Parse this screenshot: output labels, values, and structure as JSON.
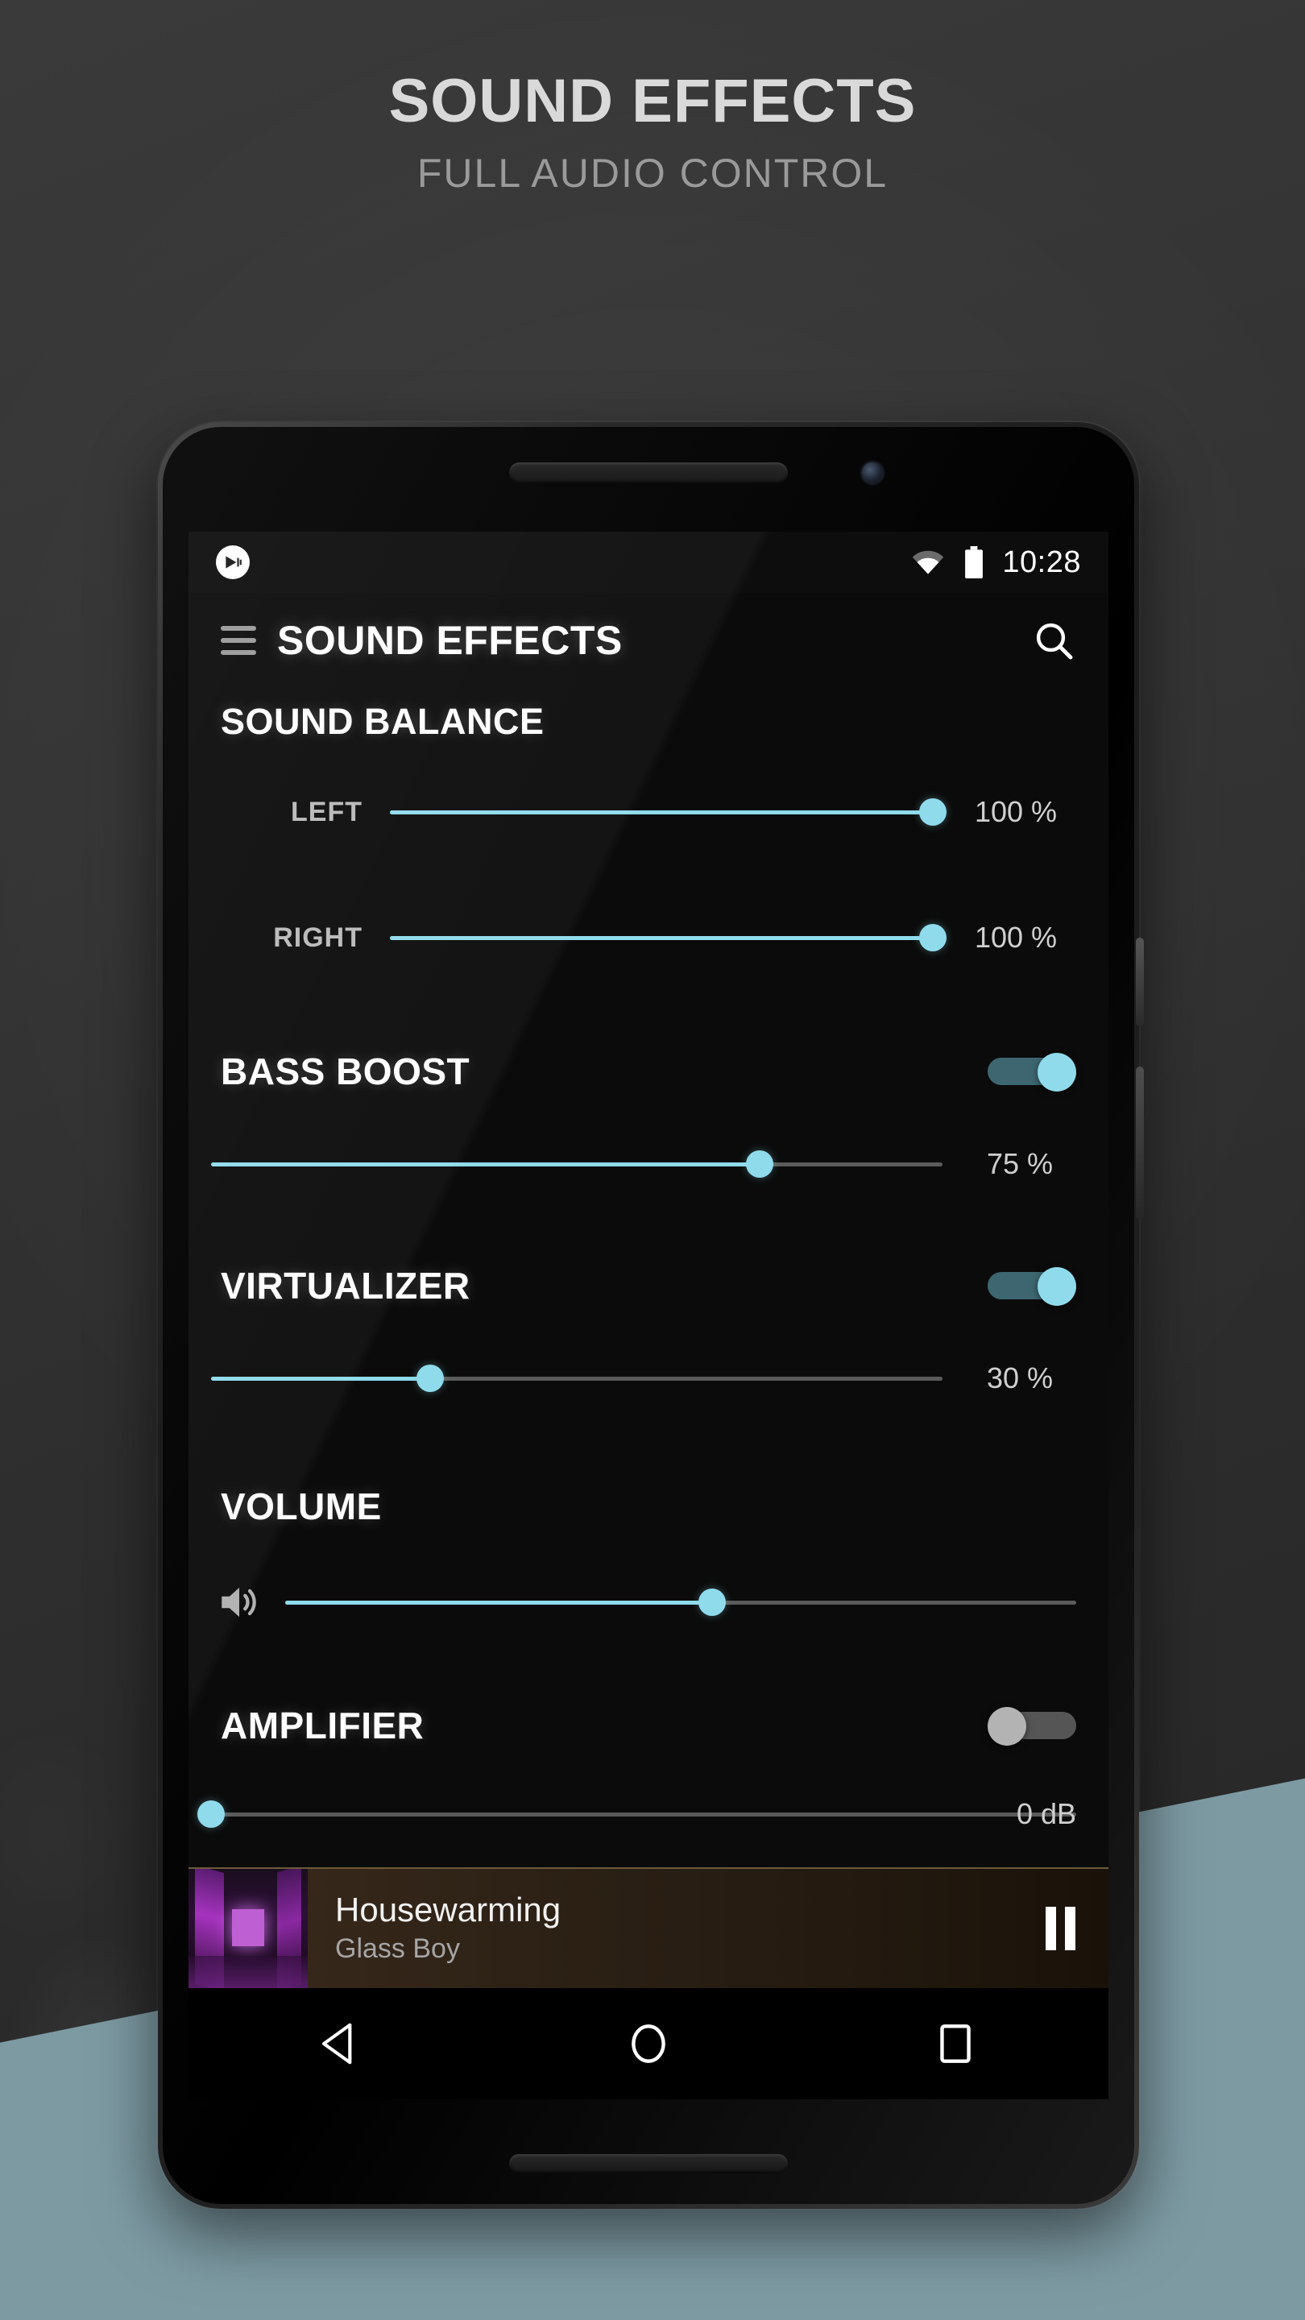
{
  "poster": {
    "title": "SOUND EFFECTS",
    "subtitle": "FULL AUDIO CONTROL"
  },
  "colors": {
    "accent": "#8fdbec",
    "toggle_on_track": "#3d6670",
    "toggle_off_track": "#555555",
    "toggle_off_knob": "#b3b3b3",
    "screen_bg": "#0b0b0b",
    "floor": "#7d9aa3",
    "nowplaying_bg": "#2e2216"
  },
  "statusbar": {
    "app_icon": "play-badge-icon",
    "wifi_icon": "wifi-icon",
    "battery_icon": "battery-full-icon",
    "time": "10:28"
  },
  "appbar": {
    "menu_icon": "hamburger-menu-icon",
    "title": "SOUND EFFECTS",
    "search_icon": "search-icon"
  },
  "sound_balance": {
    "heading": "SOUND BALANCE",
    "rows": [
      {
        "label": "LEFT",
        "value": "100 %",
        "percent": 100
      },
      {
        "label": "RIGHT",
        "value": "100 %",
        "percent": 100
      }
    ]
  },
  "effects": [
    {
      "title": "BASS BOOST",
      "toggle_state": "on",
      "value": "75 %",
      "percent": 75
    },
    {
      "title": "VIRTUALIZER",
      "toggle_state": "on",
      "value": "30 %",
      "percent": 30
    }
  ],
  "volume": {
    "title": "VOLUME",
    "icon": "speaker-volume-icon",
    "percent": 54
  },
  "amplifier": {
    "title": "AMPLIFIER",
    "toggle_state": "off",
    "value": "0 dB",
    "percent": 0
  },
  "nowplaying": {
    "album_art": "album-art-neon-corridor",
    "track": "Housewarming",
    "artist": "Glass Boy",
    "action_icon": "pause-icon"
  },
  "navbar": {
    "back": "back-triangle-icon",
    "home": "home-circle-icon",
    "recents": "recents-square-icon"
  }
}
